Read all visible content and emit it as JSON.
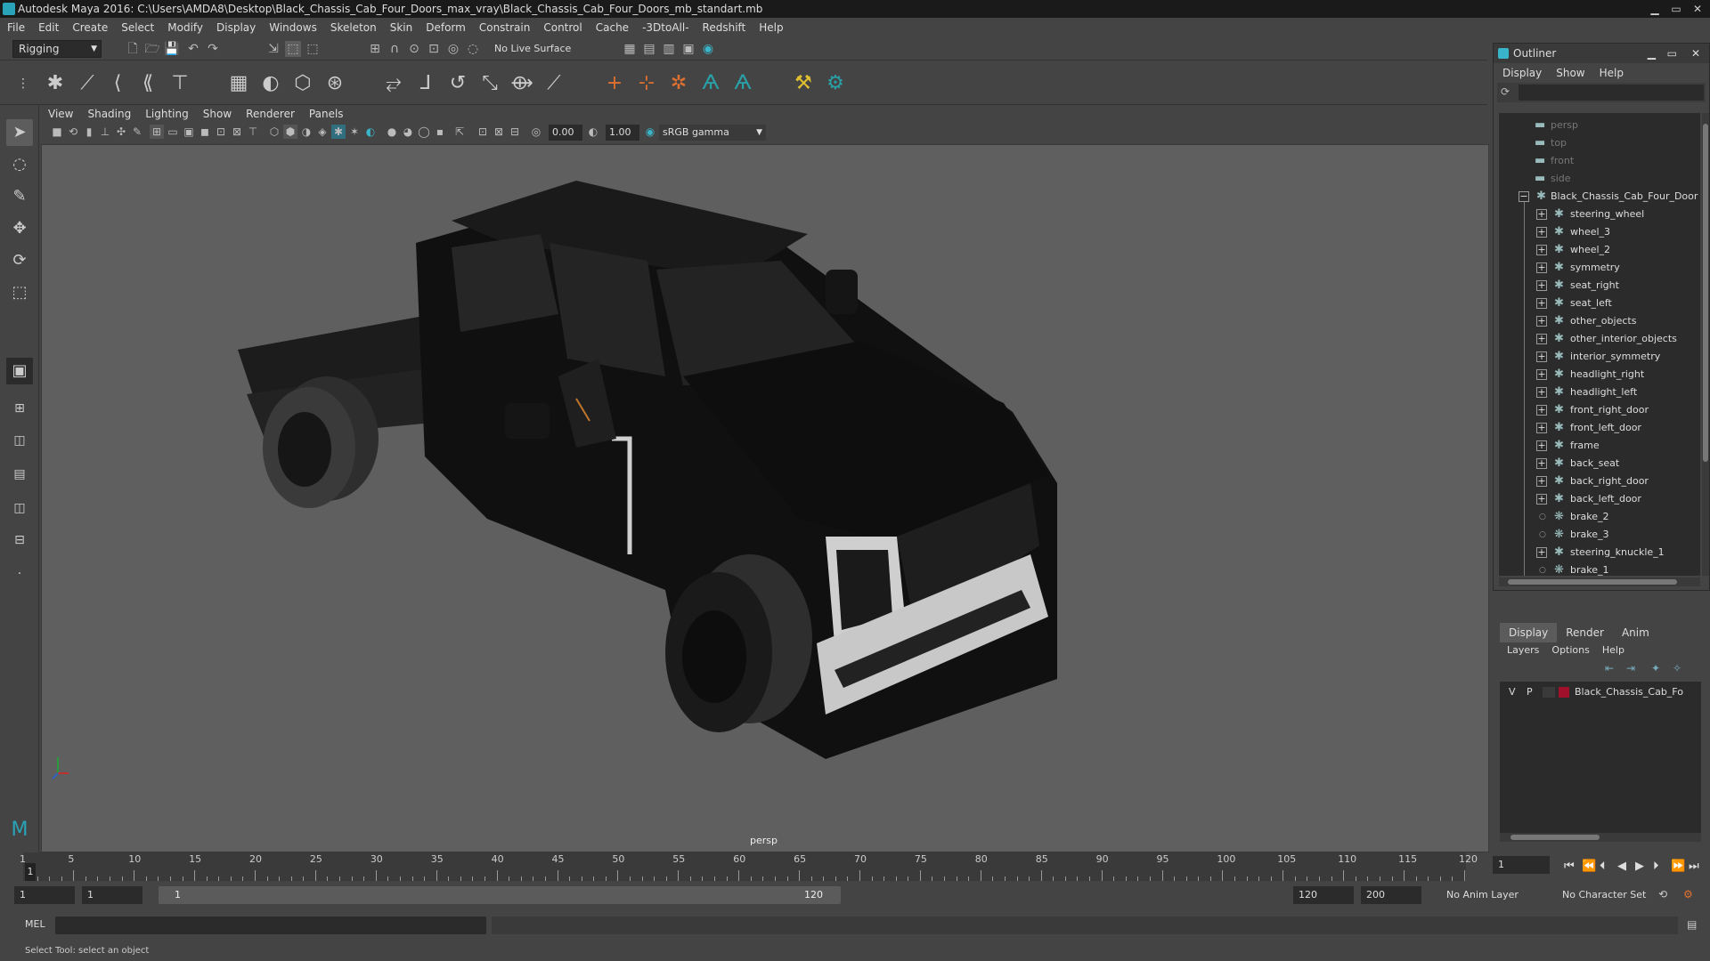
{
  "window": {
    "title": "Autodesk Maya 2016: C:\\Users\\AMDA8\\Desktop\\Black_Chassis_Cab_Four_Doors_max_vray\\Black_Chassis_Cab_Four_Doors_mb_standart.mb",
    "minimize": "▁",
    "maximize": "▭",
    "close": "✕"
  },
  "menubar": [
    "File",
    "Edit",
    "Create",
    "Select",
    "Modify",
    "Display",
    "Windows",
    "Skeleton",
    "Skin",
    "Deform",
    "Constrain",
    "Control",
    "Cache",
    "-3DtoAll-",
    "Redshift",
    "Help"
  ],
  "statusline": {
    "menu_set": "Rigging",
    "live_surface": "No Live Surface"
  },
  "viewport": {
    "menu": [
      "View",
      "Shading",
      "Lighting",
      "Show",
      "Renderer",
      "Panels"
    ],
    "near_value": "0.00",
    "exposure_value": "1.00",
    "color_space": "sRGB gamma",
    "camera_label": "persp"
  },
  "outliner": {
    "title": "Outliner",
    "menu": [
      "Display",
      "Show",
      "Help"
    ],
    "cameras": [
      "persp",
      "top",
      "front",
      "side"
    ],
    "root": "Black_Chassis_Cab_Four_Door",
    "children": [
      {
        "label": "steering_wheel",
        "expand": true
      },
      {
        "label": "wheel_3",
        "expand": true
      },
      {
        "label": "wheel_2",
        "expand": true
      },
      {
        "label": "symmetry",
        "expand": true
      },
      {
        "label": "seat_right",
        "expand": true
      },
      {
        "label": "seat_left",
        "expand": true
      },
      {
        "label": "other_objects",
        "expand": true
      },
      {
        "label": "other_interior_objects",
        "expand": true
      },
      {
        "label": "interior_symmetry",
        "expand": true
      },
      {
        "label": "headlight_right",
        "expand": true
      },
      {
        "label": "headlight_left",
        "expand": true
      },
      {
        "label": "front_right_door",
        "expand": true
      },
      {
        "label": "front_left_door",
        "expand": true
      },
      {
        "label": "frame",
        "expand": true
      },
      {
        "label": "back_seat",
        "expand": true
      },
      {
        "label": "back_right_door",
        "expand": true
      },
      {
        "label": "back_left_door",
        "expand": true
      },
      {
        "label": "brake_2",
        "expand": false
      },
      {
        "label": "brake_3",
        "expand": false
      },
      {
        "label": "steering_knuckle_1",
        "expand": true
      },
      {
        "label": "brake_1",
        "expand": false
      }
    ]
  },
  "layers": {
    "tabs": [
      "Display",
      "Render",
      "Anim"
    ],
    "menu": [
      "Layers",
      "Options",
      "Help"
    ],
    "row": {
      "v": "V",
      "p": "P",
      "name": "Black_Chassis_Cab_Fo",
      "color": "#a0102a"
    }
  },
  "timeline": {
    "ticks": [
      "1",
      "5",
      "10",
      "15",
      "20",
      "25",
      "30",
      "35",
      "40",
      "45",
      "50",
      "55",
      "60",
      "65",
      "70",
      "75",
      "80",
      "85",
      "90",
      "95",
      "100",
      "105",
      "110",
      "115",
      "120"
    ],
    "current_frame": "1",
    "current_field": "1"
  },
  "range": {
    "start": "1",
    "current": "1",
    "slider_start": "1",
    "slider_end": "120",
    "end": "120",
    "max": "200",
    "anim_layer": "No Anim Layer",
    "character_set": "No Character Set"
  },
  "cmdline": {
    "lang": "MEL"
  },
  "helpline": "Select Tool: select an object",
  "colors": {
    "accent": "#29a3b8",
    "layer_color": "#a0102a"
  }
}
